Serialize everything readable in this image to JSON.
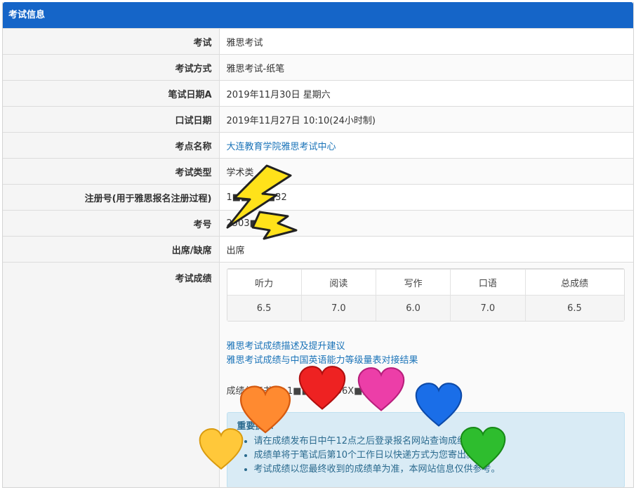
{
  "header": {
    "title": "考试信息"
  },
  "rows": [
    {
      "label": "考试",
      "value": "雅思考试"
    },
    {
      "label": "考试方式",
      "value": "雅思考试-纸笔"
    },
    {
      "label": "笔试日期A",
      "value": "2019年11月30日 星期六"
    },
    {
      "label": "口试日期",
      "value": "2019年11月27日 10:10(24小时制)"
    },
    {
      "label": "考点名称",
      "value": "大连教育学院雅思考试中心"
    },
    {
      "label": "考试类型",
      "value": "学术类"
    },
    {
      "label": "注册号(用于雅思报名注册过程)",
      "value": "1■■■■■32"
    },
    {
      "label": "考号",
      "value": "2503■■■"
    },
    {
      "label": "出席/缺席",
      "value": "出席"
    }
  ],
  "scores": {
    "label": "考试成绩",
    "headers": [
      "听力",
      "阅读",
      "写作",
      "口语",
      "总成绩"
    ],
    "values": [
      "6.5",
      "7.0",
      "6.0",
      "7.0",
      "6.5"
    ]
  },
  "links": [
    "雅思考试成绩描述及提升建议",
    "雅思考试成绩与中国英语能力等级量表对接结果"
  ],
  "certificate": {
    "text": "成绩单证书号: 1■■■■■96X■■■"
  },
  "notice": {
    "title": "重要提示",
    "items": [
      "请在成绩发布日中午12点之后登录报名网站查询成绩。",
      "成绩单将于笔试后第10个工作日以快递方式为您寄出。",
      "考试成绩以您最终收到的成绩单为准，本网站信息仅供参考。"
    ]
  },
  "colors": {
    "header_bg": "#1565c8",
    "link": "#1a73b8",
    "notice_bg": "#d9ebf5"
  },
  "stickers": [
    "lightning-sticker",
    "heart-orange",
    "heart-red",
    "heart-pink",
    "heart-blue",
    "heart-yellow",
    "heart-green"
  ]
}
